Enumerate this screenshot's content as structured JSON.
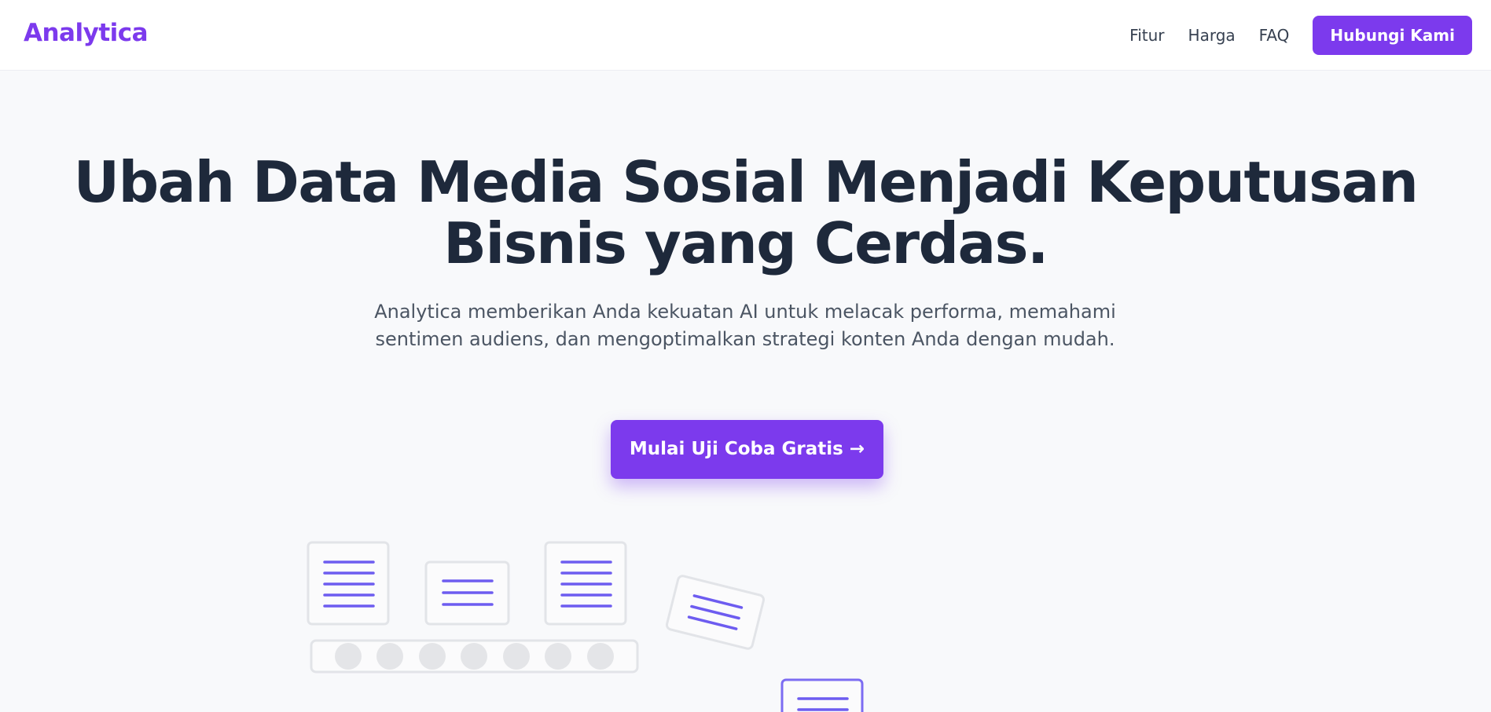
{
  "header": {
    "logo": "Analytica",
    "nav": {
      "features": "Fitur",
      "pricing": "Harga",
      "faq": "FAQ",
      "contact": "Hubungi Kami"
    }
  },
  "hero": {
    "title": "Ubah Data Media Sosial Menjadi Keputusan Bisnis yang Cerdas.",
    "subtitle": "Analytica memberikan Anda kekuatan AI untuk melacak performa, memahami sentimen audiens, dan mengoptimalkan strategi konten Anda dengan mudah.",
    "cta": "Mulai Uji Coba Gratis →"
  },
  "colors": {
    "accent": "#7c3aed",
    "heading": "#1e293b",
    "body_text": "#4b5563",
    "illustration_lines": "#6d5cf0",
    "illustration_border": "#e2e4e8"
  }
}
